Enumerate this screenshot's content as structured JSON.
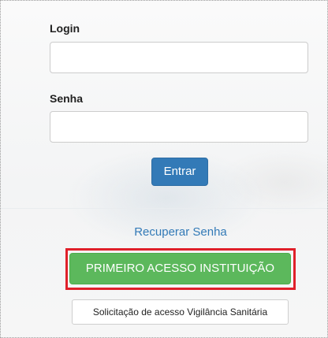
{
  "form": {
    "login_label": "Login",
    "login_value": "",
    "password_label": "Senha",
    "password_value": "",
    "submit_label": "Entrar"
  },
  "links": {
    "recover_password": "Recuperar Senha"
  },
  "actions": {
    "first_access_label": "PRIMEIRO ACESSO INSTITUIÇÃO",
    "request_access_label": "Solicitação de acesso Vigilância Sanitária"
  },
  "colors": {
    "primary": "#337ab7",
    "success": "#5cb85c",
    "highlight": "#e0202a"
  }
}
